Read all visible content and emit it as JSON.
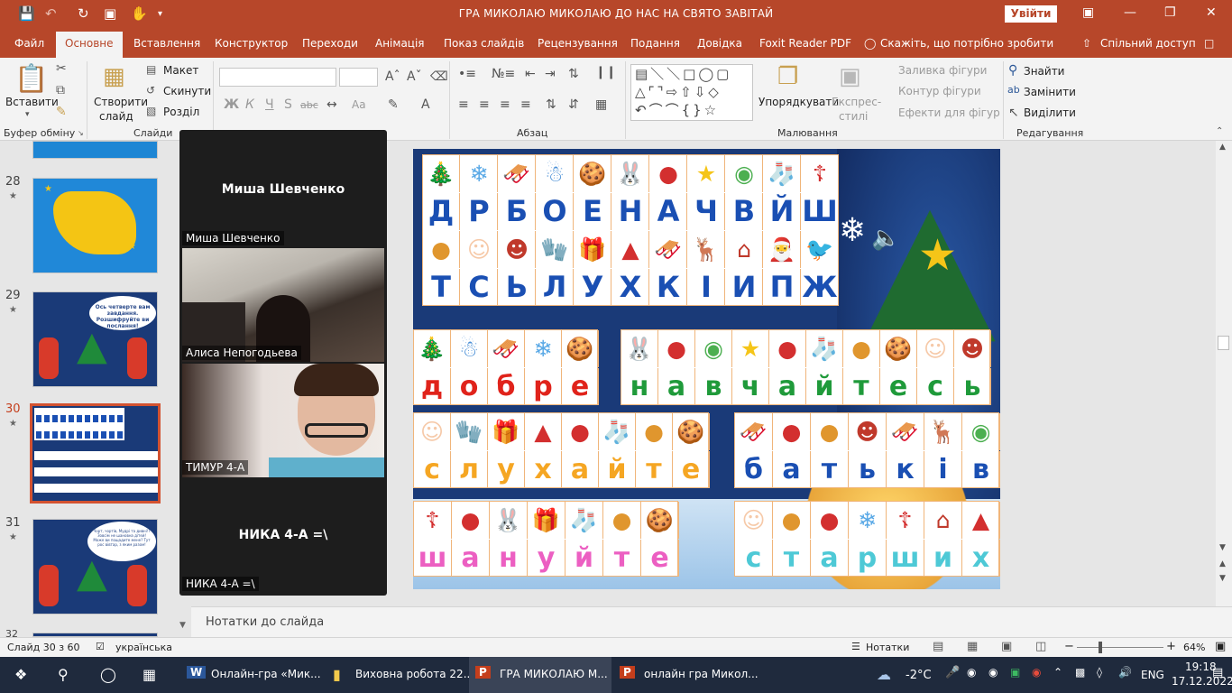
{
  "titlebar": {
    "document_title": "ГРА МИКОЛАЮ МИКОЛАЮ ДО НАС НА СВЯТО ЗАВІТАЙ",
    "signin_label": "Увійти",
    "icons": [
      "save-icon",
      "undo-icon",
      "redo-icon",
      "present-from-start-icon",
      "touch-mode-icon",
      "customize-qat-icon"
    ]
  },
  "tabs": [
    "Файл",
    "Основне",
    "Вставлення",
    "Конструктор",
    "Переходи",
    "Анімація",
    "Показ слайдів",
    "Рецензування",
    "Подання",
    "Довідка",
    "Foxit Reader PDF",
    "Скажіть, що потрібно зробити",
    "Спільний доступ"
  ],
  "active_tab": "Основне",
  "ribbon": {
    "clipboard": {
      "paste": "Вставити",
      "group": "Буфер обміну"
    },
    "slides": {
      "new_slide_line1": "Створити",
      "new_slide_line2": "слайд",
      "layout": "Макет",
      "reset": "Скинути",
      "section": "Розділ",
      "group": "Слайди"
    },
    "font": {
      "bold": "Ж",
      "italic": "К",
      "underline": "Ч",
      "strike": "S",
      "abc": "abc",
      "case": "Aa"
    },
    "paragraph": {
      "group": "Абзац"
    },
    "drawing": {
      "arrange": "Упорядкувати",
      "quick_styles_line1": "Експрес-",
      "quick_styles_line2": "стилі",
      "fill": "Заливка фігури",
      "outline": "Контур фігури",
      "effects": "Ефекти для фігур",
      "group": "Малювання"
    },
    "editing": {
      "find": "Знайти",
      "replace": "Замінити",
      "select": "Виділити",
      "group": "Редагування"
    }
  },
  "thumbnails": [
    {
      "num": "28",
      "star": "★"
    },
    {
      "num": "29",
      "star": "★",
      "bubble": "Ось четверте вам завдання. Розшифруйте ви послання!"
    },
    {
      "num": "30",
      "star": "★",
      "selected": true
    },
    {
      "num": "31",
      "star": "★",
      "bubble": "Чорт, чортів, Мудрі та дивні!? Зовсім не шановна дітей! Може ви пощадите мене? Тут рос вівтар, з яким разом!"
    },
    {
      "num": "32"
    }
  ],
  "participants": [
    {
      "title": "Миша Шевченко",
      "label": "Миша Шевченко",
      "video": false
    },
    {
      "label": "Алиса Непогодьева",
      "video": true
    },
    {
      "label": "ТИМУР 4-А",
      "video": true
    },
    {
      "title": "НИКА 4-А =\\",
      "label": "НИКА 4-А =\\",
      "video": false
    }
  ],
  "slide": {
    "grid_icons_row1": [
      "tree",
      "snowflake",
      "sled",
      "snowman",
      "gingerbread",
      "bunny",
      "ornament-red",
      "star",
      "snowglobe",
      "stocking",
      "nicholas"
    ],
    "grid_letters_row1": [
      "Д",
      "Р",
      "Б",
      "О",
      "Е",
      "Н",
      "А",
      "Ч",
      "В",
      "Й",
      "Ш"
    ],
    "grid_icons_row2": [
      "ornament-gold",
      "angel",
      "devil",
      "mitten",
      "gifts",
      "santa-hat",
      "sleigh",
      "reindeer",
      "house",
      "santa",
      "bird"
    ],
    "grid_letters_row2": [
      "Т",
      "С",
      "Ь",
      "Л",
      "У",
      "Х",
      "К",
      "І",
      "И",
      "П",
      "Ж"
    ],
    "words": [
      {
        "letters": [
          "д",
          "о",
          "б",
          "р",
          "е"
        ],
        "icons": [
          "tree",
          "snowman",
          "sled",
          "snowflake",
          "gingerbread"
        ],
        "color": "#e0231b"
      },
      {
        "letters": [
          "н",
          "а",
          "в",
          "ч",
          "а",
          "й",
          "т",
          "е",
          "с",
          "ь"
        ],
        "icons": [
          "bunny",
          "ornament-red",
          "snowglobe",
          "star",
          "ornament-red",
          "stocking",
          "ornament-gold",
          "gingerbread",
          "angel",
          "devil"
        ],
        "color": "#1f9a3a"
      },
      {
        "letters": [
          "с",
          "л",
          "у",
          "х",
          "а",
          "й",
          "т",
          "е"
        ],
        "icons": [
          "angel",
          "mitten",
          "gifts",
          "santa-hat",
          "ornament-red",
          "stocking",
          "ornament-gold",
          "gingerbread"
        ],
        "color": "#f5a623"
      },
      {
        "letters": [
          "б",
          "а",
          "т",
          "ь",
          "к",
          "і",
          "в"
        ],
        "icons": [
          "sled",
          "ornament-red",
          "ornament-gold",
          "devil",
          "sleigh",
          "reindeer",
          "snowglobe"
        ],
        "color": "#1a4fb3"
      },
      {
        "letters": [
          "ш",
          "а",
          "н",
          "у",
          "й",
          "т",
          "е"
        ],
        "icons": [
          "nicholas",
          "ornament-red",
          "bunny",
          "gifts",
          "stocking",
          "ornament-gold",
          "gingerbread"
        ],
        "color": "#ec5fc2"
      },
      {
        "letters": [
          "с",
          "т",
          "а",
          "р",
          "ш",
          "и",
          "х"
        ],
        "icons": [
          "angel",
          "ornament-gold",
          "ornament-red",
          "snowflake",
          "nicholas",
          "house",
          "santa-hat"
        ],
        "color": "#4ec9d6"
      }
    ]
  },
  "notes_placeholder": "Нотатки до слайда",
  "status": {
    "slide_info": "Слайд 30 з 60",
    "language": "українська",
    "notes": "Нотатки",
    "zoom": "64%"
  },
  "taskbar": {
    "apps": [
      "Онлайн-гра «Мик...",
      "Виховна робота 22...",
      "ГРА МИКОЛАЮ М...",
      "онлайн гра Микол..."
    ],
    "weather": "-2°C",
    "lang": "ENG",
    "time": "19:18",
    "date": "17.12.2022"
  },
  "colors": {
    "accent": "#b7472a",
    "selected_thumb": "#d35230"
  }
}
